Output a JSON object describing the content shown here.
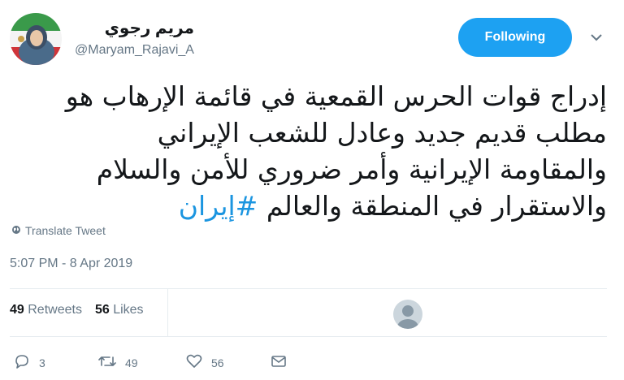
{
  "profile": {
    "display_name": "مريم رجوي",
    "handle": "@Maryam_Rajavi_A",
    "avatar": "avatar"
  },
  "follow_button": {
    "label": "Following"
  },
  "more_icon": "chevron-down-icon",
  "tweet": {
    "lines": [
      "إدراج قوات الحرس القمعية في قائمة الإرهاب هو",
      "مطلب قديم جديد وعادل للشعب الإيراني",
      "والمقاومة الإيرانية وأمر ضروري للأمن والسلام"
    ],
    "last_line_text": "والاستقرار في المنطقة والعالم ",
    "hashtag": "#إيران"
  },
  "translate": {
    "label": "Translate Tweet",
    "icon": "globe-icon"
  },
  "timestamp": "5:07 PM - 8 Apr 2019",
  "stats": {
    "retweets_count": "49",
    "retweets_label": "Retweets",
    "likes_count": "56",
    "likes_label": "Likes"
  },
  "actions": {
    "reply_count": "3",
    "retweet_count": "49",
    "like_count": "56"
  },
  "colors": {
    "accent": "#1da1f2",
    "hashtag": "#1b95e0",
    "muted": "#657786",
    "divider": "#e6ecf0"
  }
}
